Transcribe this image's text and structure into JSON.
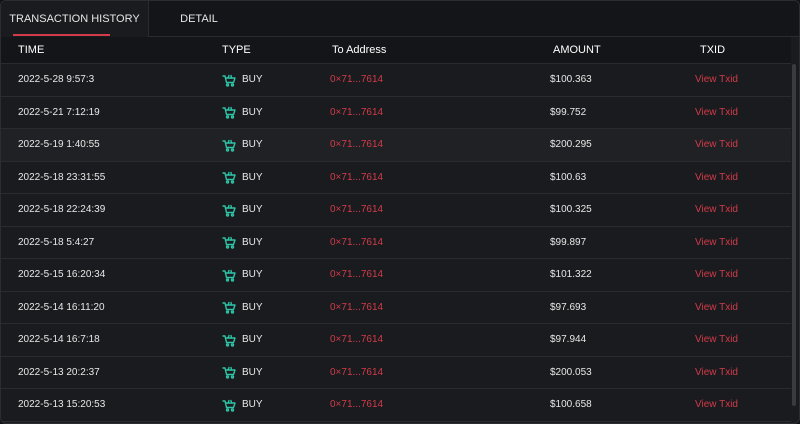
{
  "tabs": [
    {
      "label": "TRANSACTION HISTORY"
    },
    {
      "label": "DETAIL"
    }
  ],
  "columns": {
    "time": "TIME",
    "type": "TYPE",
    "to_address": "To Address",
    "amount": "AMOUNT",
    "txid": "TXID"
  },
  "colors": {
    "accent": "#d23b4a",
    "buy_icon": "#2ec4a7",
    "background": "#1a1b1e"
  },
  "rows": [
    {
      "time": "2022-5-28 9:57:3",
      "type": "BUY",
      "type_icon": "cart-icon",
      "address": "0×71...7614",
      "amount": "$100.363",
      "txid": "View Txid"
    },
    {
      "time": "2022-5-21 7:12:19",
      "type": "BUY",
      "type_icon": "cart-icon",
      "address": "0×71...7614",
      "amount": "$99.752",
      "txid": "View Txid"
    },
    {
      "time": "2022-5-19 1:40:55",
      "type": "BUY",
      "type_icon": "cart-icon",
      "address": "0×71...7614",
      "amount": "$200.295",
      "txid": "View Txid"
    },
    {
      "time": "2022-5-18 23:31:55",
      "type": "BUY",
      "type_icon": "cart-icon",
      "address": "0×71...7614",
      "amount": "$100.63",
      "txid": "View Txid"
    },
    {
      "time": "2022-5-18 22:24:39",
      "type": "BUY",
      "type_icon": "cart-icon",
      "address": "0×71...7614",
      "amount": "$100.325",
      "txid": "View Txid"
    },
    {
      "time": "2022-5-18 5:4:27",
      "type": "BUY",
      "type_icon": "cart-icon",
      "address": "0×71...7614",
      "amount": "$99.897",
      "txid": "View Txid"
    },
    {
      "time": "2022-5-15 16:20:34",
      "type": "BUY",
      "type_icon": "cart-icon",
      "address": "0×71...7614",
      "amount": "$101.322",
      "txid": "View Txid"
    },
    {
      "time": "2022-5-14 16:11:20",
      "type": "BUY",
      "type_icon": "cart-icon",
      "address": "0×71...7614",
      "amount": "$97.693",
      "txid": "View Txid"
    },
    {
      "time": "2022-5-14 16:7:18",
      "type": "BUY",
      "type_icon": "cart-icon",
      "address": "0×71...7614",
      "amount": "$97.944",
      "txid": "View Txid"
    },
    {
      "time": "2022-5-13 20:2:37",
      "type": "BUY",
      "type_icon": "cart-icon",
      "address": "0×71...7614",
      "amount": "$200.053",
      "txid": "View Txid"
    },
    {
      "time": "2022-5-13 15:20:53",
      "type": "BUY",
      "type_icon": "cart-icon",
      "address": "0×71...7614",
      "amount": "$100.658",
      "txid": "View Txid"
    }
  ]
}
